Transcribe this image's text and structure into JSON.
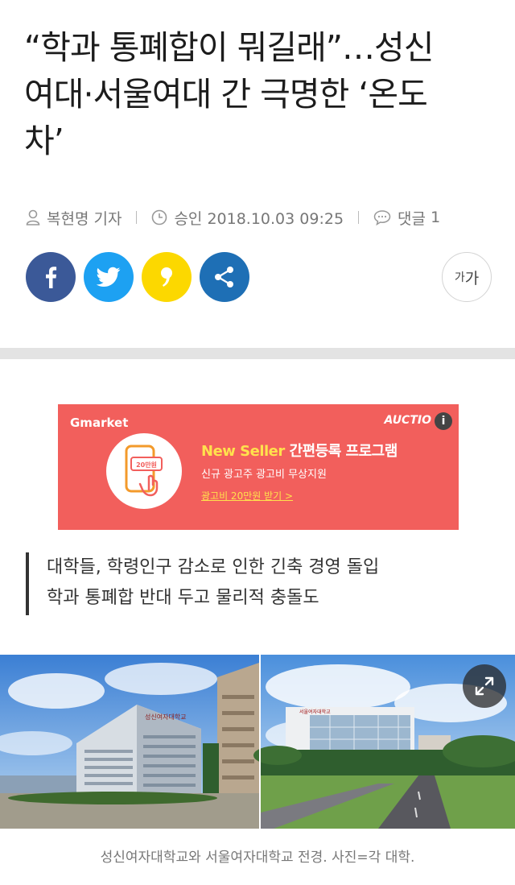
{
  "article": {
    "headline_line1": "“학과 통폐합이 뭐길래”…성신",
    "headline_line2": "여대·서울여대 간 극명한 ‘온도",
    "headline_line3": "차’",
    "author": "복현명 기자",
    "approved": "승인 2018.10.03 09:25",
    "comments_label": "댓글",
    "comments_count": "1",
    "summary_line1": "대학들, 학령인구 감소로 인한 긴축 경영 돌입",
    "summary_line2": "학과 통폐합 반대 두고 물리적 충돌도",
    "photo_caption": "성신여자대학교와 서울여자대학교 전경. 사진=각 대학.",
    "photo_sign_left": "성신여자대학교",
    "photo_sign_right": "서울여자대학교"
  },
  "font_size_button": {
    "small": "가",
    "big": "가"
  },
  "share": {
    "icons": [
      "facebook-icon",
      "twitter-icon",
      "kakao-icon",
      "share-icon"
    ],
    "colors": {
      "facebook": "#3b5998",
      "twitter": "#1da1f2",
      "kakao": "#fcd800",
      "share": "#1e6fb5"
    }
  },
  "ad": {
    "brand_left": "Gmarket",
    "brand_right": "AUCTIO",
    "info_icon": "i",
    "title_en": "New Seller",
    "title_ko": " 간편등록 프로그램",
    "subtitle": "신규 광고주 광고비 무상지원",
    "cta": "광고비 20만원 받기 >",
    "coupon": "20만원",
    "background": "#f25f5c"
  }
}
